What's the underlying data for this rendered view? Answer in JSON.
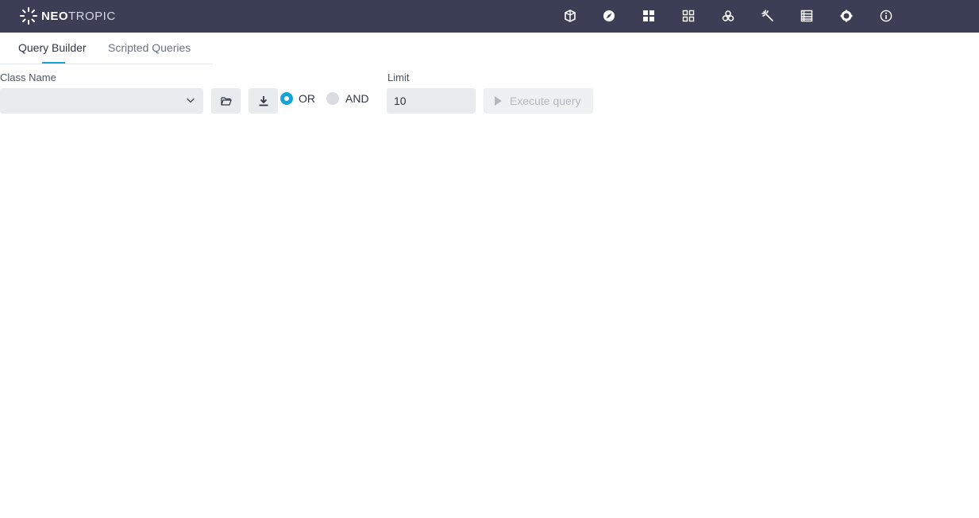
{
  "brand": {
    "name_bold": "NEO",
    "name_light": "TROPIC"
  },
  "nav_icons": [
    "schema-icon",
    "navigator-icon",
    "dashboard-icon",
    "widgets-icon",
    "process-icon",
    "tools-icon",
    "list-icon",
    "settings-icon",
    "info-icon"
  ],
  "tabs": [
    {
      "label": "Query Builder",
      "active": true
    },
    {
      "label": "Scripted Queries",
      "active": false
    }
  ],
  "form": {
    "class_name_label": "Class Name",
    "class_name_value": "",
    "logic_options": [
      {
        "label": "OR",
        "selected": true
      },
      {
        "label": "AND",
        "selected": false
      }
    ],
    "limit_label": "Limit",
    "limit_value": "10",
    "execute_label": "Execute query"
  },
  "colors": {
    "topbar": "#3b3e54",
    "accent": "#17a2d8",
    "field_bg": "#e9ecef"
  }
}
